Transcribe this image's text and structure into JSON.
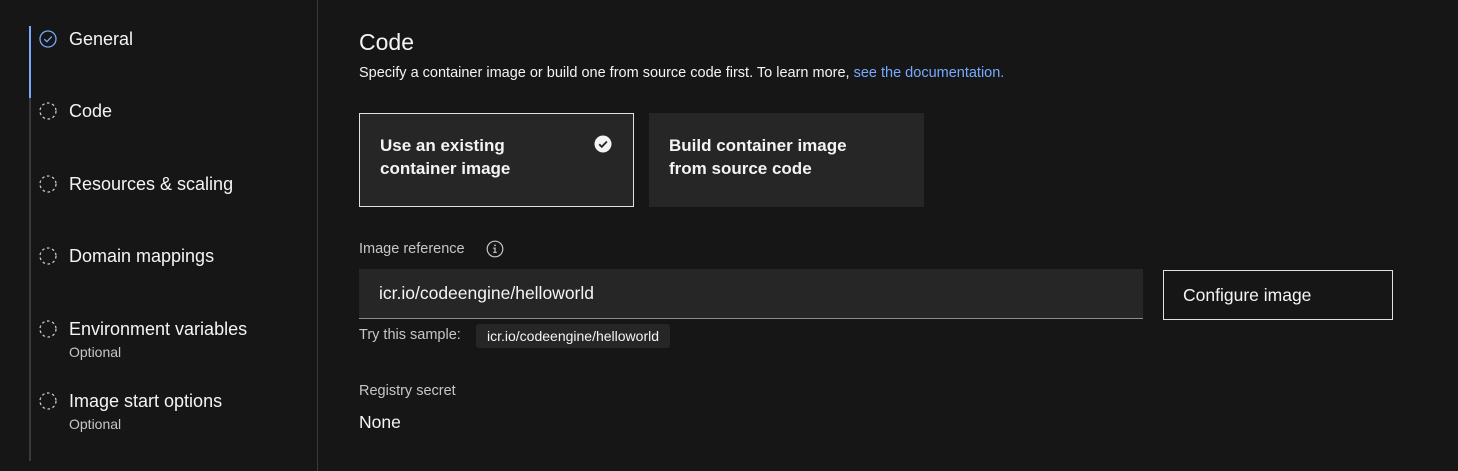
{
  "progress": {
    "steps": [
      {
        "label": "General",
        "optional": "",
        "state": "complete",
        "icon": "check-circle-icon"
      },
      {
        "label": "Code",
        "optional": "",
        "state": "incomplete",
        "icon": "dashed-circle-icon"
      },
      {
        "label": "Resources & scaling",
        "optional": "",
        "state": "incomplete",
        "icon": "dashed-circle-icon"
      },
      {
        "label": "Domain mappings",
        "optional": "",
        "state": "incomplete",
        "icon": "dashed-circle-icon"
      },
      {
        "label": "Environment variables",
        "optional": "Optional",
        "state": "incomplete",
        "icon": "dashed-circle-icon"
      },
      {
        "label": "Image start options",
        "optional": "Optional",
        "state": "incomplete",
        "icon": "dashed-circle-icon"
      }
    ]
  },
  "code": {
    "title": "Code",
    "description": "Specify a container image or build one from source code first. To learn more, ",
    "doc_link": "see the documentation.",
    "tiles": {
      "existing": {
        "label": "Use an existing container image",
        "selected": true
      },
      "build": {
        "label": "Build container image from source code",
        "selected": false
      }
    },
    "image_reference": {
      "label": "Image reference",
      "value": "icr.io/codeengine/helloworld"
    },
    "configure_button": "Configure image",
    "sample": {
      "label": "Try this sample:",
      "value": "icr.io/codeengine/helloworld"
    },
    "registry_secret": {
      "label": "Registry secret",
      "value": "None"
    }
  },
  "colors": {
    "background": "#161616",
    "layer": "#262626",
    "link": "#78a9ff",
    "text_primary": "#f4f4f4",
    "text_secondary": "#c6c6c6",
    "border": "#393939"
  }
}
